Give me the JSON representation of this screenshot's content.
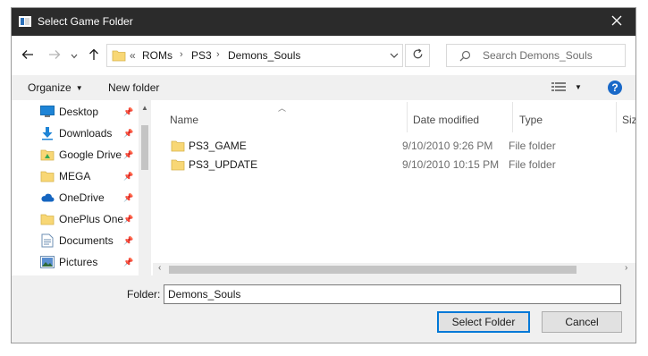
{
  "window": {
    "title": "Select Game Folder"
  },
  "address": {
    "overflow": "«",
    "segments": [
      "ROMs",
      "PS3",
      "Demons_Souls"
    ],
    "separator": "›"
  },
  "search": {
    "placeholder": "Search Demons_Souls"
  },
  "toolbar": {
    "organize": "Organize",
    "new_folder": "New folder"
  },
  "nav_pane": {
    "items": [
      {
        "label": "Desktop",
        "icon": "desktop-icon",
        "pinned": true
      },
      {
        "label": "Downloads",
        "icon": "download-icon",
        "pinned": true
      },
      {
        "label": "Google Drive",
        "icon": "google-drive-icon",
        "pinned": true
      },
      {
        "label": "MEGA",
        "icon": "folder-icon",
        "pinned": true
      },
      {
        "label": "OneDrive",
        "icon": "cloud-icon",
        "pinned": true
      },
      {
        "label": "OnePlus One",
        "icon": "folder-icon",
        "pinned": true
      },
      {
        "label": "Documents",
        "icon": "documents-icon",
        "pinned": true
      },
      {
        "label": "Pictures",
        "icon": "pictures-icon",
        "pinned": true
      }
    ]
  },
  "file_list": {
    "columns": [
      "Name",
      "Date modified",
      "Type",
      "Size"
    ],
    "rows": [
      {
        "name": "PS3_GAME",
        "date": "9/10/2010 9:26 PM",
        "type": "File folder"
      },
      {
        "name": "PS3_UPDATE",
        "date": "9/10/2010 10:15 PM",
        "type": "File folder"
      }
    ]
  },
  "folder_field": {
    "label": "Folder:",
    "value": "Demons_Souls"
  },
  "buttons": {
    "select": "Select Folder",
    "cancel": "Cancel"
  },
  "colors": {
    "titlebar": "#2b2b2b",
    "accent": "#0078d7",
    "folder": "#f8d775"
  }
}
